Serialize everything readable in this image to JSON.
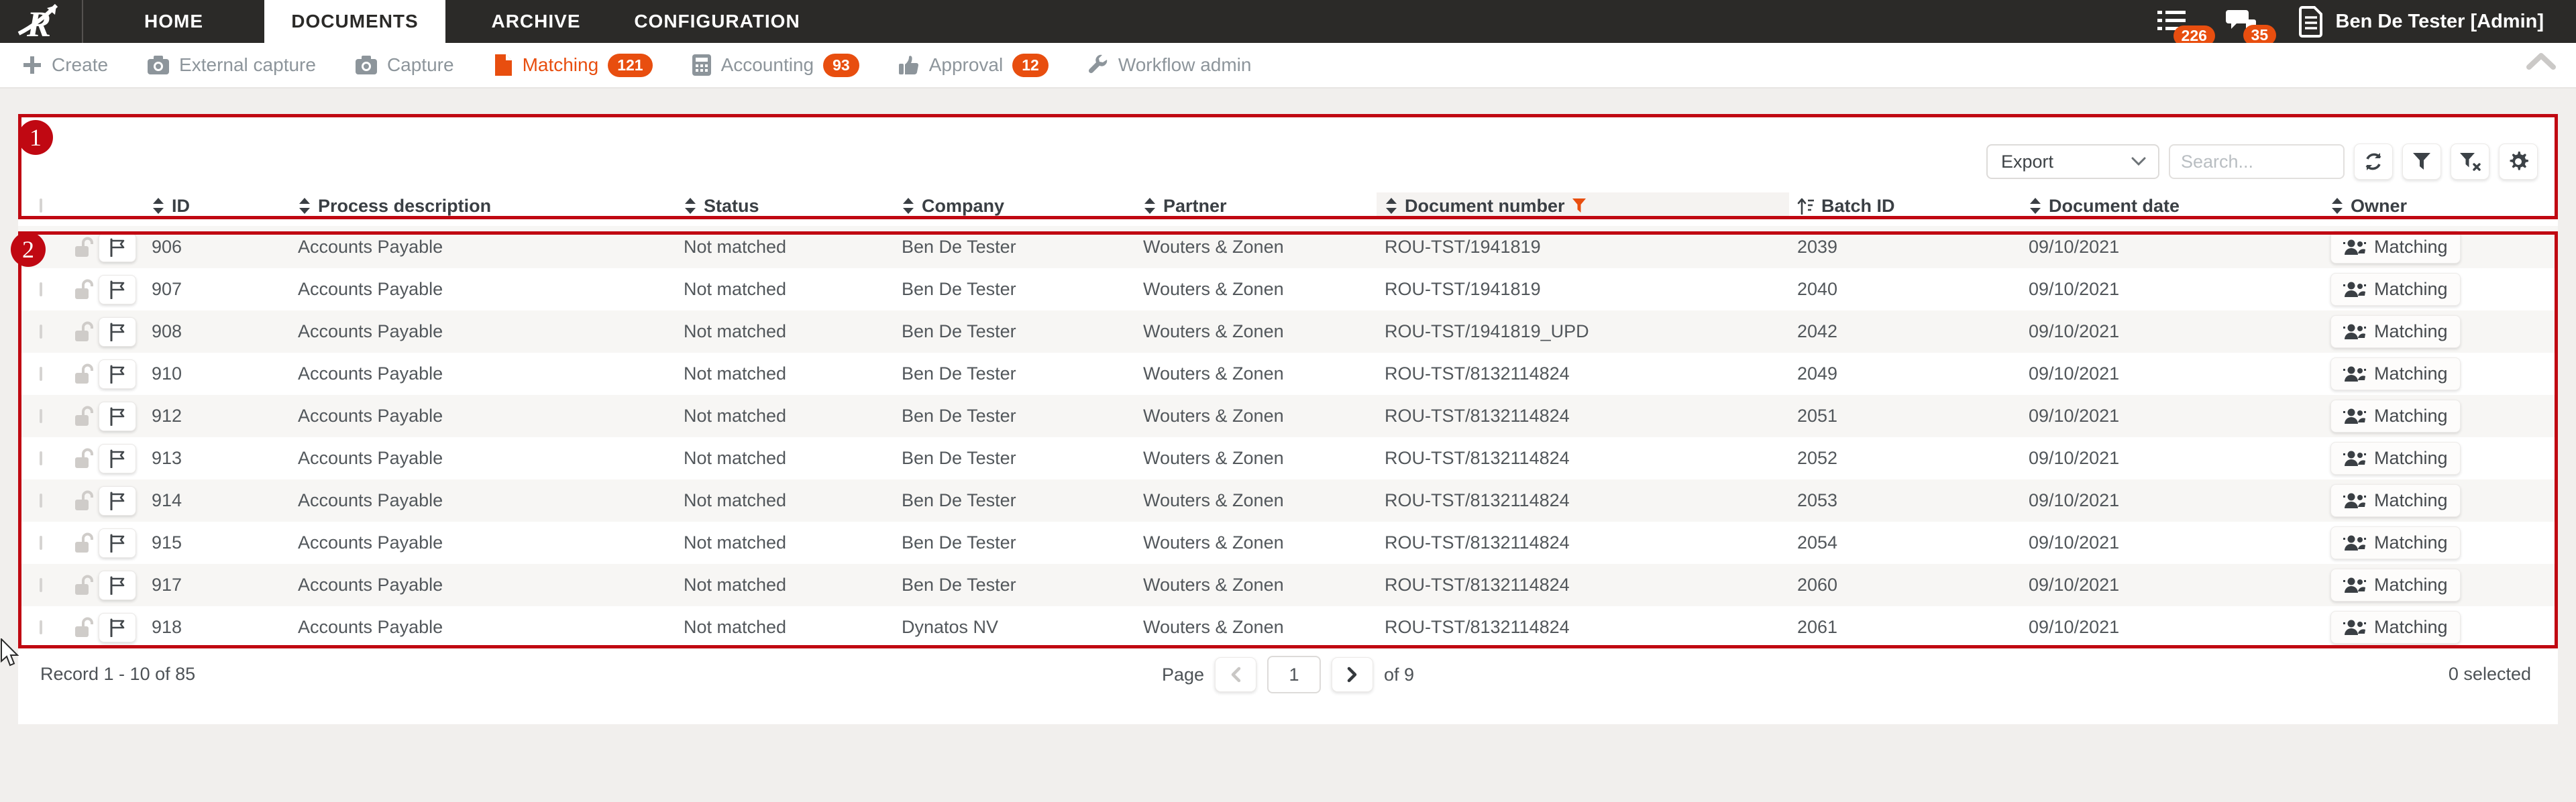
{
  "colors": {
    "accent_orange": "#E84E0F",
    "annotation_red": "#C00812",
    "nav_bg": "#2B2A28"
  },
  "nav": {
    "tabs": [
      {
        "label": "HOME",
        "active": false
      },
      {
        "label": "DOCUMENTS",
        "active": true
      },
      {
        "label": "ARCHIVE",
        "active": false
      },
      {
        "label": "CONFIGURATION",
        "active": false
      }
    ],
    "queue_badge": "226",
    "messages_badge": "35",
    "user_name": "Ben De Tester [Admin]"
  },
  "toolbar": {
    "items": [
      {
        "label": "Create",
        "icon": "plus-icon"
      },
      {
        "label": "External capture",
        "icon": "camera-icon"
      },
      {
        "label": "Capture",
        "icon": "camera-icon"
      },
      {
        "label": "Matching",
        "icon": "document-icon",
        "count": "121",
        "active": true
      },
      {
        "label": "Accounting",
        "icon": "calculator-icon",
        "count": "93",
        "active": false
      },
      {
        "label": "Approval",
        "icon": "thumbs-up-icon",
        "count": "12",
        "active": false
      },
      {
        "label": "Workflow admin",
        "icon": "wrench-icon"
      }
    ]
  },
  "annotations": {
    "step1": "1",
    "step2": "2"
  },
  "controls": {
    "export_label": "Export",
    "search_placeholder": "Search..."
  },
  "table": {
    "columns": [
      {
        "label": "ID"
      },
      {
        "label": "Process description"
      },
      {
        "label": "Status"
      },
      {
        "label": "Company"
      },
      {
        "label": "Partner"
      },
      {
        "label": "Document number",
        "filtered": true
      },
      {
        "label": "Batch ID",
        "sorted": "asc"
      },
      {
        "label": "Document date"
      },
      {
        "label": "Owner"
      }
    ],
    "rows": [
      {
        "id": "906",
        "process": "Accounts Payable",
        "status": "Not matched",
        "company": "Ben De Tester",
        "partner": "Wouters & Zonen",
        "document_number": "ROU-TST/1941819",
        "batch_id": "2039",
        "document_date": "09/10/2021",
        "owner": "Matching"
      },
      {
        "id": "907",
        "process": "Accounts Payable",
        "status": "Not matched",
        "company": "Ben De Tester",
        "partner": "Wouters & Zonen",
        "document_number": "ROU-TST/1941819",
        "batch_id": "2040",
        "document_date": "09/10/2021",
        "owner": "Matching"
      },
      {
        "id": "908",
        "process": "Accounts Payable",
        "status": "Not matched",
        "company": "Ben De Tester",
        "partner": "Wouters & Zonen",
        "document_number": "ROU-TST/1941819_UPD",
        "batch_id": "2042",
        "document_date": "09/10/2021",
        "owner": "Matching"
      },
      {
        "id": "910",
        "process": "Accounts Payable",
        "status": "Not matched",
        "company": "Ben De Tester",
        "partner": "Wouters & Zonen",
        "document_number": "ROU-TST/8132114824",
        "batch_id": "2049",
        "document_date": "09/10/2021",
        "owner": "Matching"
      },
      {
        "id": "912",
        "process": "Accounts Payable",
        "status": "Not matched",
        "company": "Ben De Tester",
        "partner": "Wouters & Zonen",
        "document_number": "ROU-TST/8132114824",
        "batch_id": "2051",
        "document_date": "09/10/2021",
        "owner": "Matching"
      },
      {
        "id": "913",
        "process": "Accounts Payable",
        "status": "Not matched",
        "company": "Ben De Tester",
        "partner": "Wouters & Zonen",
        "document_number": "ROU-TST/8132114824",
        "batch_id": "2052",
        "document_date": "09/10/2021",
        "owner": "Matching"
      },
      {
        "id": "914",
        "process": "Accounts Payable",
        "status": "Not matched",
        "company": "Ben De Tester",
        "partner": "Wouters & Zonen",
        "document_number": "ROU-TST/8132114824",
        "batch_id": "2053",
        "document_date": "09/10/2021",
        "owner": "Matching"
      },
      {
        "id": "915",
        "process": "Accounts Payable",
        "status": "Not matched",
        "company": "Ben De Tester",
        "partner": "Wouters & Zonen",
        "document_number": "ROU-TST/8132114824",
        "batch_id": "2054",
        "document_date": "09/10/2021",
        "owner": "Matching"
      },
      {
        "id": "917",
        "process": "Accounts Payable",
        "status": "Not matched",
        "company": "Ben De Tester",
        "partner": "Wouters & Zonen",
        "document_number": "ROU-TST/8132114824",
        "batch_id": "2060",
        "document_date": "09/10/2021",
        "owner": "Matching"
      },
      {
        "id": "918",
        "process": "Accounts Payable",
        "status": "Not matched",
        "company": "Dynatos NV",
        "partner": "Wouters & Zonen",
        "document_number": "ROU-TST/8132114824",
        "batch_id": "2061",
        "document_date": "09/10/2021",
        "owner": "Matching"
      }
    ]
  },
  "footer": {
    "record_text": "Record 1 - 10 of 85",
    "page_label": "Page",
    "page_value": "1",
    "page_total": "of 9",
    "selected_text": "0 selected"
  }
}
